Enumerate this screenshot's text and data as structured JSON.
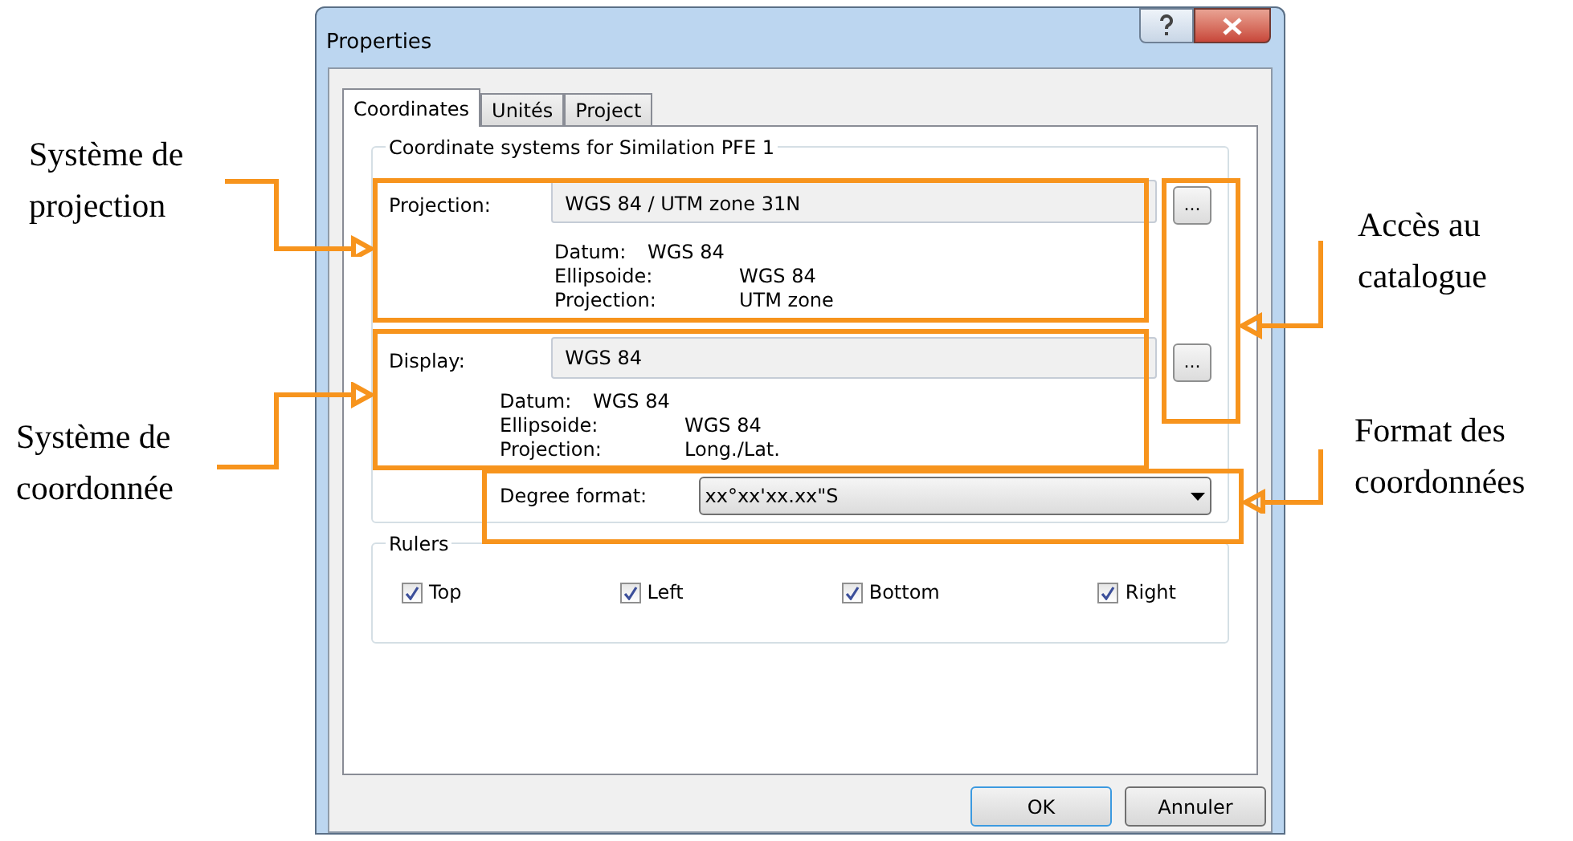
{
  "window": {
    "title": "Properties"
  },
  "tabs": [
    {
      "label": "Coordinates",
      "selected": true
    },
    {
      "label": "Unités",
      "selected": false
    },
    {
      "label": "Project",
      "selected": false
    }
  ],
  "group": {
    "title": "Coordinate systems for Similation PFE 1",
    "projection": {
      "label": "Projection:",
      "value": "WGS 84 / UTM zone 31N",
      "button": "...",
      "details": [
        {
          "label": "Datum:",
          "value": "WGS 84"
        },
        {
          "label": "Ellipsoide:",
          "value": "WGS 84"
        },
        {
          "label": "Projection:",
          "value": "UTM zone"
        }
      ]
    },
    "display": {
      "label": "Display:",
      "value": "WGS 84",
      "button": "...",
      "details": [
        {
          "label": "Datum:",
          "value": "WGS 84"
        },
        {
          "label": "Ellipsoide:",
          "value": "WGS 84"
        },
        {
          "label": "Projection:",
          "value": "Long./Lat."
        }
      ]
    },
    "degree_format": {
      "label": "Degree format:",
      "value": "xx°xx'xx.xx\"S"
    }
  },
  "rulers": {
    "title": "Rulers",
    "items": [
      {
        "label": "Top",
        "checked": true
      },
      {
        "label": "Left",
        "checked": true
      },
      {
        "label": "Bottom",
        "checked": true
      },
      {
        "label": "Right",
        "checked": true
      }
    ]
  },
  "buttons": [
    {
      "label": "OK",
      "default": true
    },
    {
      "label": "Annuler",
      "default": false
    }
  ],
  "annotations": [
    {
      "lines": [
        "Système de",
        "projection"
      ]
    },
    {
      "lines": [
        "Accès au",
        "catalogue"
      ]
    },
    {
      "lines": [
        "Système de",
        "coordonnée"
      ]
    },
    {
      "lines": [
        "Format des",
        "coordonnées"
      ]
    }
  ]
}
